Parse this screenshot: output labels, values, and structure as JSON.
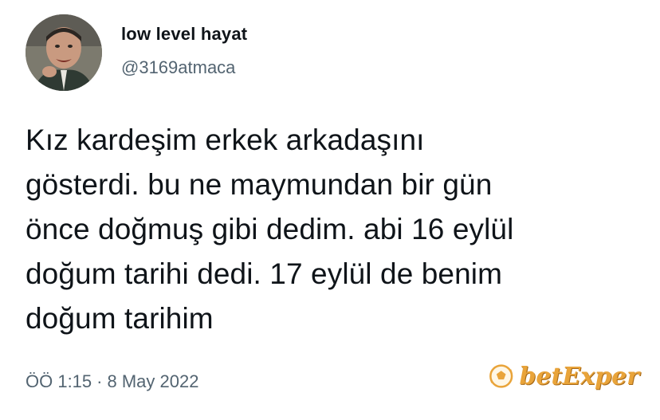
{
  "author": {
    "display_name": "low level hayat",
    "handle": "@3169atmaca"
  },
  "tweet": {
    "text": "Kız kardeşim erkek arkadaşını\ngösterdi. bu ne maymundan bir gün\nönce doğmuş gibi dedim. abi 16 eylül\ndoğum tarihi dedi. 17 eylül de benim\ndoğum tarihim",
    "time": "ÖÖ 1:15",
    "separator": "·",
    "date": "8 May 2022"
  },
  "watermark": {
    "text": "betExper",
    "icon": "soccer-ball-icon",
    "color": "#e9a43a"
  },
  "colors": {
    "text": "#0f1419",
    "secondary": "#536471",
    "background": "#ffffff"
  }
}
